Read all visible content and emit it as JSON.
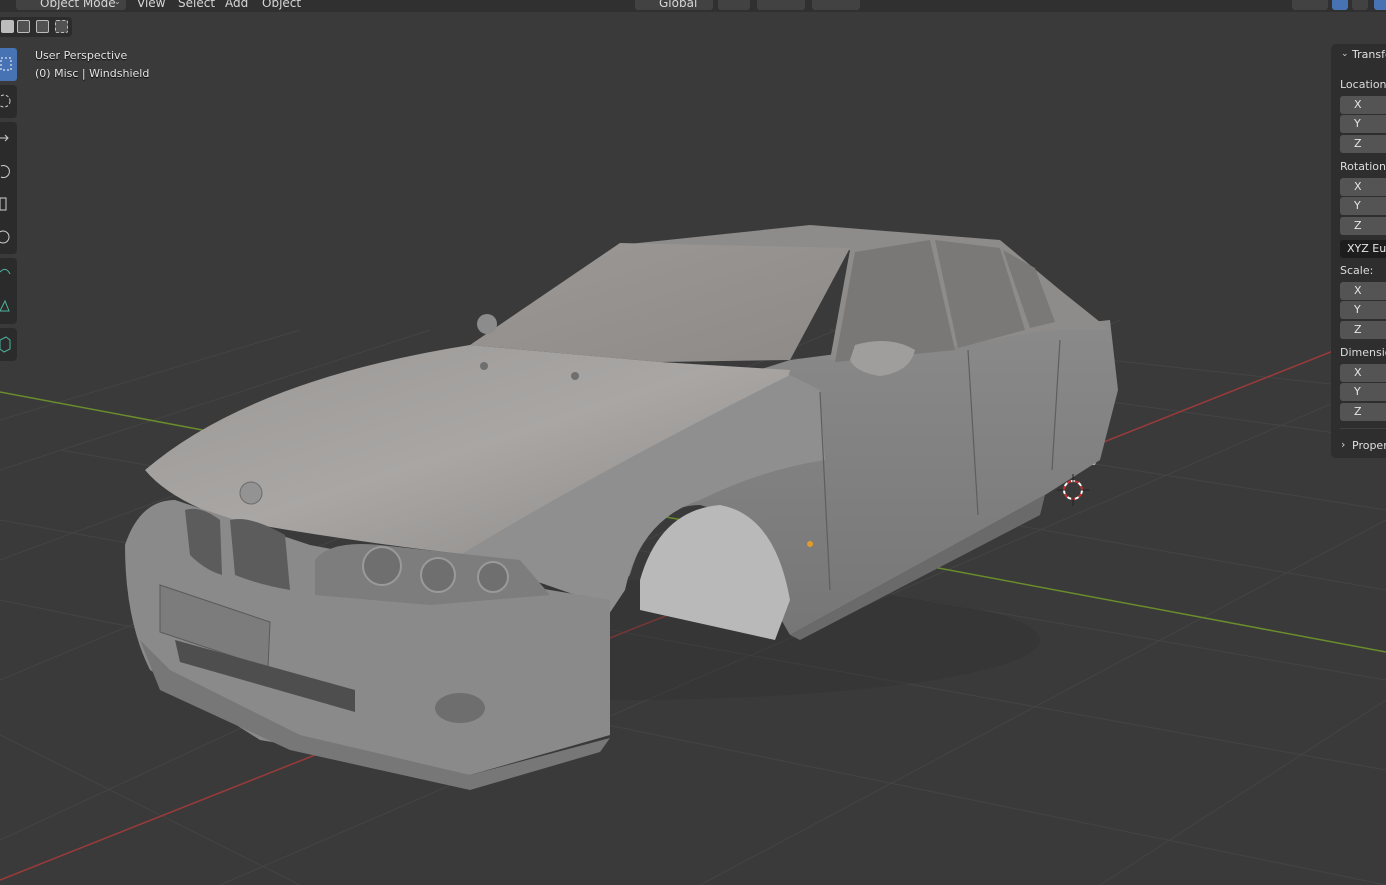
{
  "header": {
    "mode_label": "Object Mode",
    "menus": [
      "View",
      "Select",
      "Add",
      "Object"
    ],
    "orientation_label": "Global"
  },
  "viewport": {
    "perspective_label": "User Perspective",
    "object_info": "(0) Misc | Windshield"
  },
  "toolbar": {
    "tools": [
      "select-box",
      "cursor",
      "move",
      "rotate",
      "scale",
      "transform",
      "annotate",
      "measure",
      "add-cube"
    ],
    "active_tool": "select-box"
  },
  "npanel": {
    "transform_title": "Transform",
    "location_label": "Location:",
    "rotation_label": "Rotation:",
    "rotation_mode": "XYZ Euler",
    "scale_label": "Scale:",
    "dimensions_label": "Dimensions:",
    "properties_title": "Properties",
    "axis_x": "X",
    "axis_y": "Y",
    "axis_z": "Z"
  },
  "colors": {
    "background": "#3a3a3a",
    "grid": "#444444",
    "x_axis": "#9b3a3a",
    "y_axis": "#6a8c2c",
    "accent": "#4772b3",
    "model": "#8d8d8d"
  }
}
